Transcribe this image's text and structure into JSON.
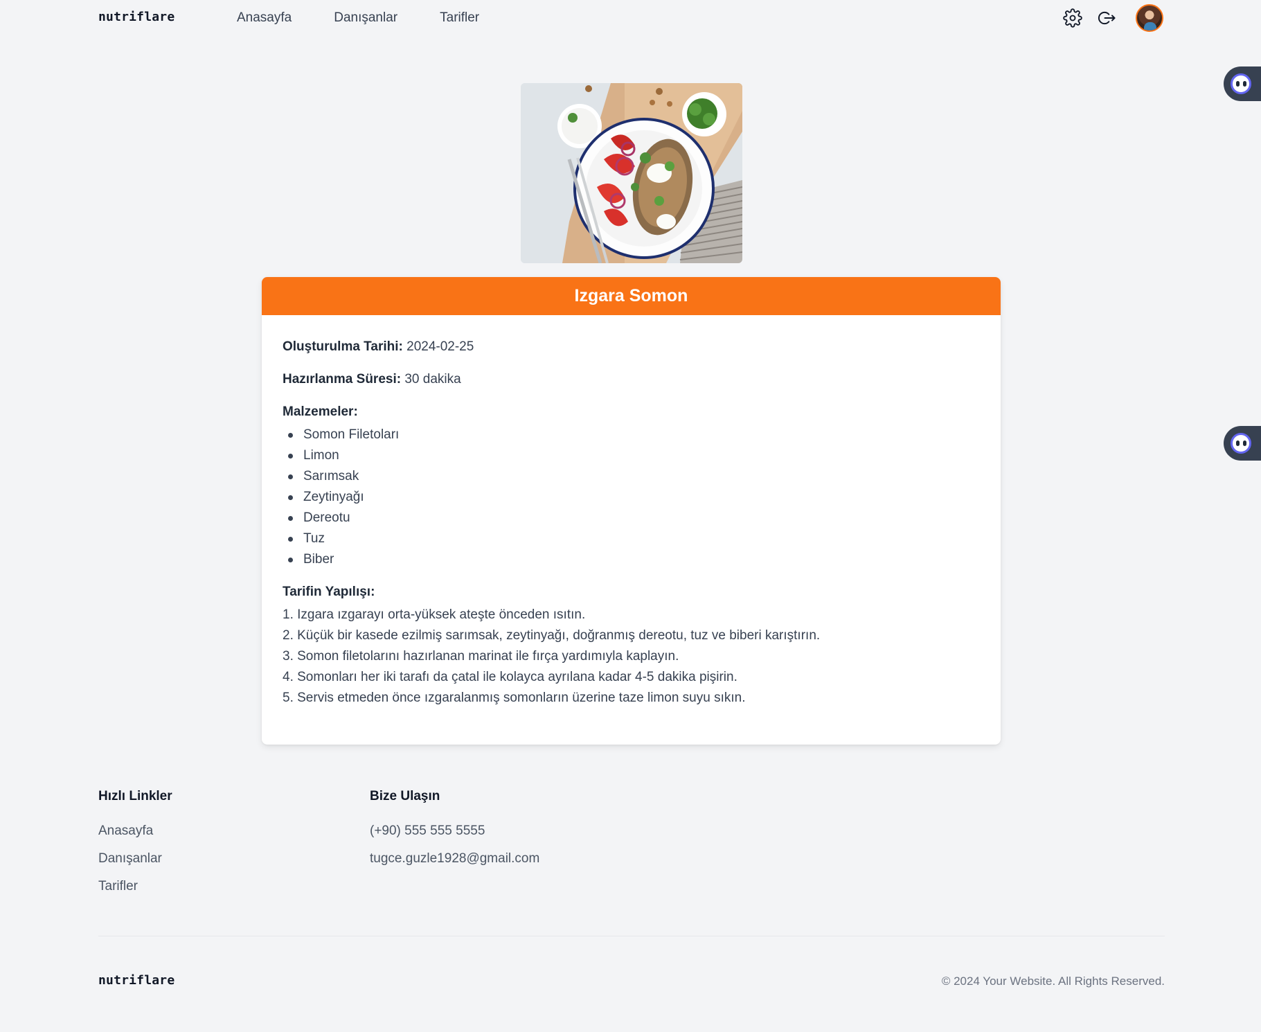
{
  "header": {
    "logo": "nutriflare",
    "nav": [
      "Anasayfa",
      "Danışanlar",
      "Tarifler"
    ],
    "icons": [
      "gear-icon",
      "logout-icon",
      "avatar"
    ]
  },
  "recipe": {
    "title": "Izgara Somon",
    "created_label": "Oluşturulma Tarihi:",
    "created_value": "2024-02-25",
    "prep_label": "Hazırlanma Süresi:",
    "prep_value": "30 dakika",
    "ingredients_label": "Malzemeler:",
    "ingredients": [
      "Somon Filetoları",
      "Limon",
      "Sarımsak",
      "Zeytinyağı",
      "Dereotu",
      "Tuz",
      "Biber"
    ],
    "steps_label": "Tarifin Yapılışı:",
    "steps": [
      "1. Izgara ızgarayı orta-yüksek ateşte önceden ısıtın.",
      "2. Küçük bir kasede ezilmiş sarımsak, zeytinyağı, doğranmış dereotu, tuz ve biberi karıştırın.",
      "3. Somon filetolarını hazırlanan marinat ile fırça yardımıyla kaplayın.",
      "4. Somonları her iki tarafı da çatal ile kolayca ayrılana kadar 4-5 dakika pişirin.",
      "5. Servis etmeden önce ızgaralanmış somonların üzerine taze limon suyu sıkın."
    ]
  },
  "footer": {
    "quick_links_title": "Hızlı Linkler",
    "quick_links": [
      "Anasayfa",
      "Danışanlar",
      "Tarifler"
    ],
    "contact_title": "Bize Ulaşın",
    "phone": "(+90) 555 555 5555",
    "email": "tugce.guzle1928@gmail.com",
    "logo": "nutriflare",
    "copyright": "© 2024 Your Website. All Rights Reserved."
  },
  "colors": {
    "accent": "#f97316",
    "background": "#f3f4f6",
    "card": "#ffffff",
    "widget": "#374151"
  }
}
